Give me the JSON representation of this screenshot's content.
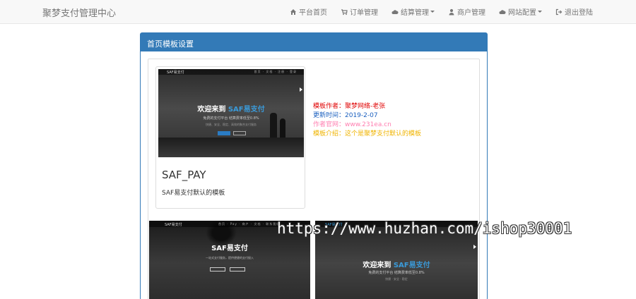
{
  "navbar": {
    "brand": "聚梦支付管理中心",
    "items": [
      {
        "label": "平台首页",
        "icon": "home-icon",
        "dropdown": false
      },
      {
        "label": "订单管理",
        "icon": "cart-icon",
        "dropdown": false
      },
      {
        "label": "结算管理",
        "icon": "cloud-icon",
        "dropdown": true
      },
      {
        "label": "商户管理",
        "icon": "user-icon",
        "dropdown": false
      },
      {
        "label": "网站配置",
        "icon": "cloud-icon",
        "dropdown": true
      },
      {
        "label": "退出登陆",
        "icon": "logout-icon",
        "dropdown": false
      }
    ]
  },
  "panel": {
    "title": "首页模板设置"
  },
  "template": {
    "thumb": {
      "logo": "SAF易支付",
      "nav_links": "首页 · 文档 · 注册 · 登录",
      "hero_prefix": "欢迎来到",
      "hero_highlight": "SAF易支付",
      "sub": "免费的支付平台 结算费率低至0.8%",
      "sub2": "快捷、安全、稳定、高效的聚合支付服务"
    },
    "name": "SAF_PAY",
    "desc": "SAF易支付默认的模板",
    "info": {
      "author": "模板作者：聚梦网络-老张",
      "date": "更新时间：2019-2-07",
      "site": "作者官网：www.231ea.cn",
      "intro": "模板介绍：这个是聚梦支付默认的模板"
    }
  },
  "thumbs_bottom": [
    {
      "logo": "SAF易支付",
      "nav_links": "首页 · Pay · 商户 · 文档 · 联系我们",
      "title": "SAF易支付",
      "sub": "一站式支付服务，提供便捷的支付接入"
    },
    {
      "logo": "SAF易支付",
      "hero_prefix": "欢迎来到",
      "hero_highlight": "SAF易支付",
      "sub": "免费的支付平台 结算费率低至0.8%",
      "sub2": "快捷 · 安全 · 稳定"
    }
  ],
  "watermark": "https://www.huzhan.com/ishop30001",
  "colors": {
    "accent": "#337ab7",
    "author": "#e00000",
    "date": "#1a5fbf",
    "site": "#ff7fb0",
    "intro": "#f0b400"
  }
}
